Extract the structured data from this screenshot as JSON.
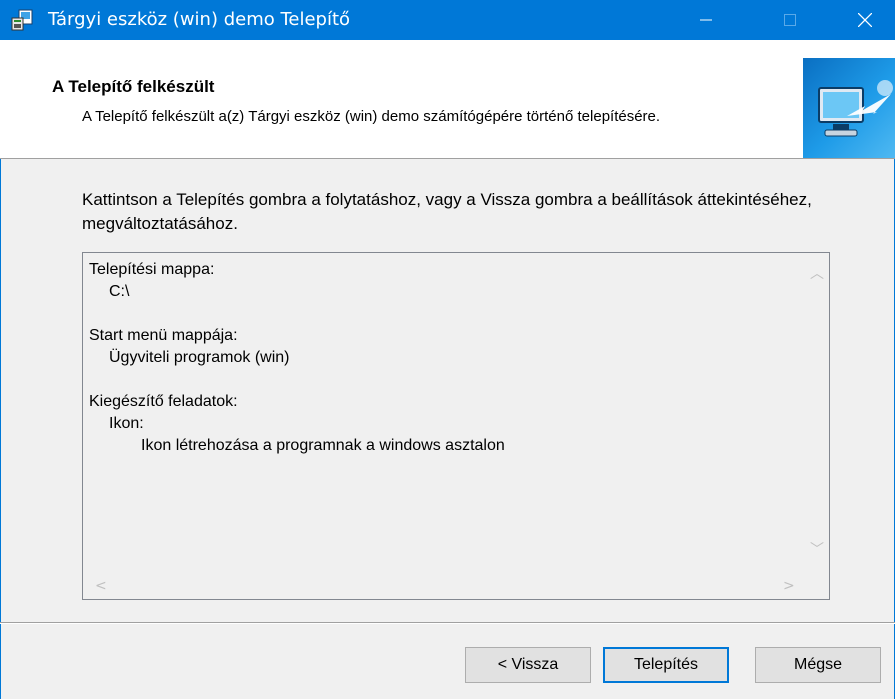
{
  "window": {
    "title": "Tárgyi eszköz (win) demo Telepítő",
    "accent_color": "#0078d7",
    "icon": "installer-icon"
  },
  "header": {
    "title": "A Telepítő felkészült",
    "description": "A Telepítő felkészült a(z) Tárgyi eszköz (win) demo számítógépére történő telepítésére."
  },
  "intro": "Kattintson a Telepítés gombra a folytatáshoz, vagy a Vissza gombra a beállítások áttekintéséhez, megváltoztatásához.",
  "memo": {
    "install_dir_label": "Telepítési mappa:",
    "install_dir_value": "C:\\",
    "start_menu_label": "Start menü mappája:",
    "start_menu_value": "Ügyviteli programok (win)",
    "tasks_label": "Kiegészítő feladatok:",
    "tasks_group": "Ikon:",
    "tasks_item": "Ikon létrehozása a programnak a windows asztalon"
  },
  "buttons": {
    "back": "< Vissza",
    "install": "Telepítés",
    "cancel": "Mégse"
  }
}
